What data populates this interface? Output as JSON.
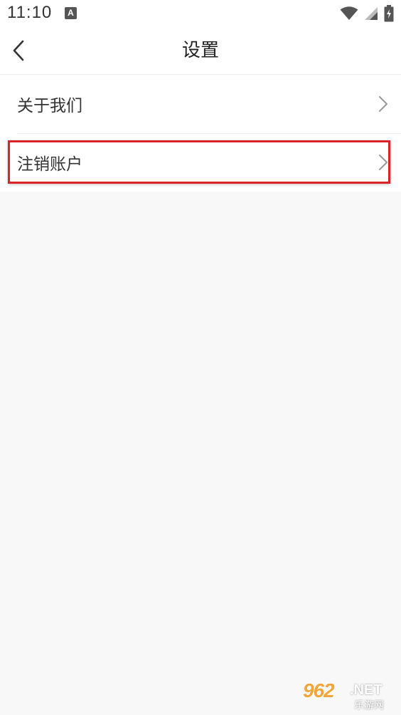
{
  "status_bar": {
    "time": "11:10",
    "notification_icon": "a-icon",
    "icons": [
      "wifi-icon",
      "signal-icon",
      "battery-icon"
    ]
  },
  "nav": {
    "back_icon": "chevron-left-icon",
    "title": "设置"
  },
  "settings": {
    "items": [
      {
        "label": "关于我们",
        "icon": "chevron-right-icon"
      },
      {
        "label": "注销账户",
        "icon": "chevron-right-icon"
      }
    ]
  },
  "annotation": {
    "highlight_color": "#d8232a"
  },
  "watermark": {
    "number": "962",
    "domain": ".NET",
    "text_cn": "乐游网"
  },
  "colors": {
    "background": "#f8f8f8",
    "surface": "#ffffff",
    "text_primary": "#333333",
    "chevron": "#999999"
  }
}
